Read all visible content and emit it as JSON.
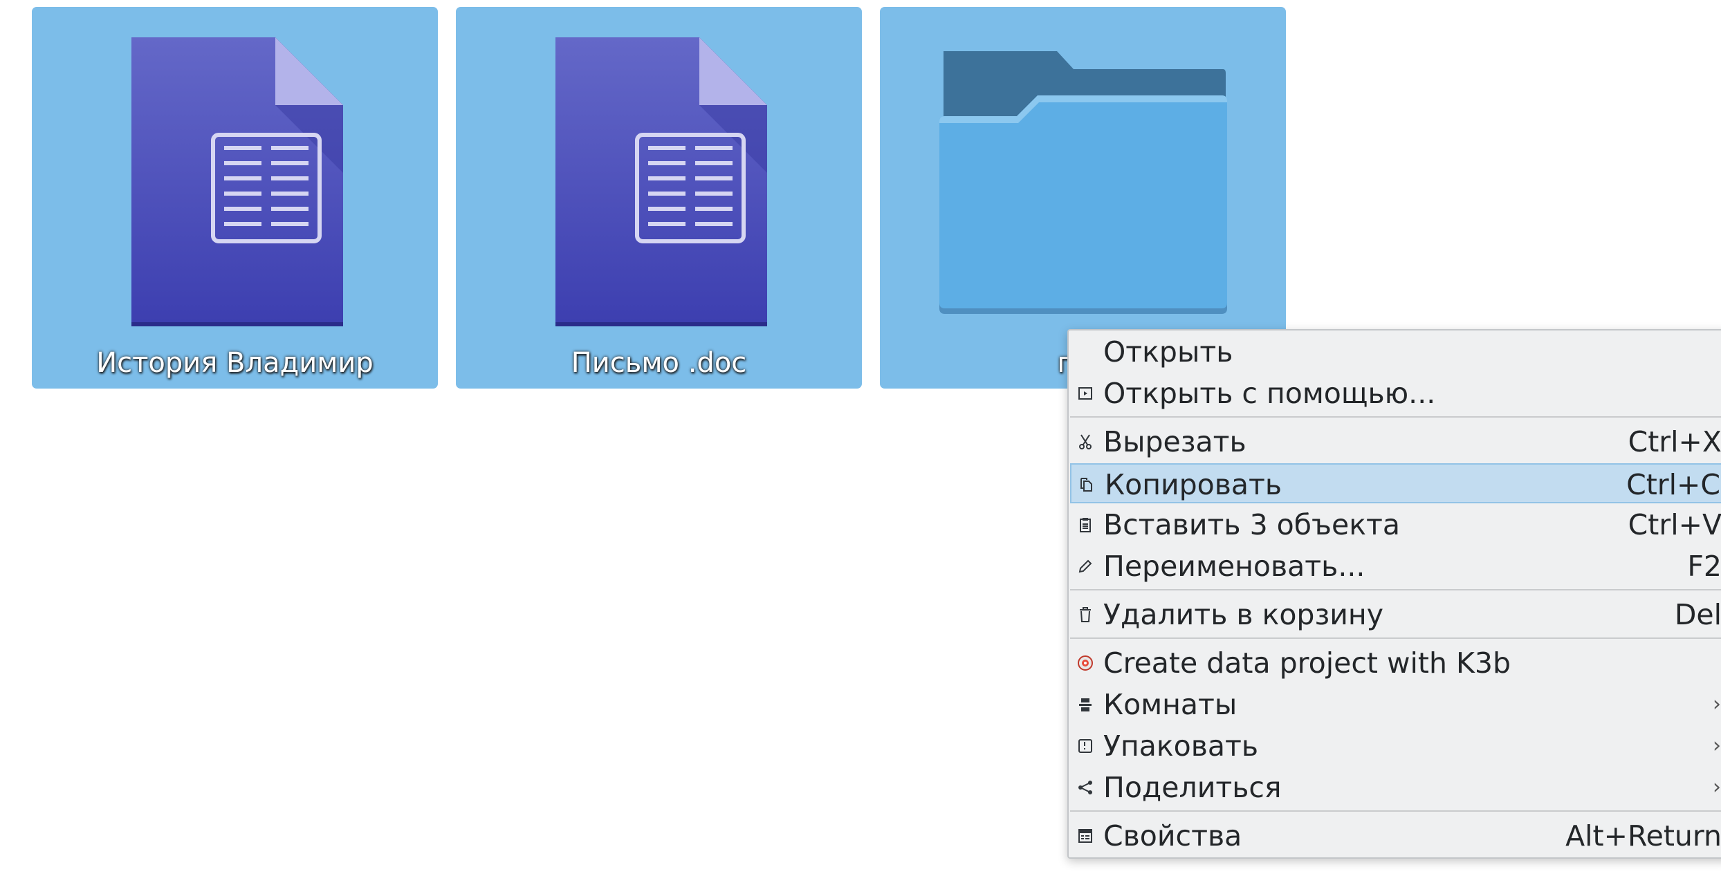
{
  "desktop": {
    "files": [
      {
        "name": "История Владимир",
        "type": "document",
        "icon": "document-icon",
        "selected": true
      },
      {
        "name": "Письмо .doc",
        "type": "document",
        "icon": "document-icon",
        "selected": true
      },
      {
        "name": "пис",
        "type": "folder",
        "icon": "folder-icon",
        "selected": true
      }
    ],
    "selection_color": "#7cbde9"
  },
  "context_menu": {
    "items": [
      {
        "label": "Открыть",
        "shortcut": "",
        "icon": "",
        "submenu": false
      },
      {
        "label": "Открыть с помощью...",
        "shortcut": "",
        "icon": "open-with-icon",
        "submenu": false
      },
      {
        "label": "Вырезать",
        "shortcut": "Ctrl+X",
        "icon": "scissors-icon",
        "submenu": false
      },
      {
        "label": "Копировать",
        "shortcut": "Ctrl+C",
        "icon": "copy-icon",
        "submenu": false,
        "highlighted": true
      },
      {
        "label": "Вставить 3 объекта",
        "shortcut": "Ctrl+V",
        "icon": "paste-icon",
        "submenu": false
      },
      {
        "label": "Переименовать...",
        "shortcut": "F2",
        "icon": "pencil-icon",
        "submenu": false
      },
      {
        "label": "Удалить в корзину",
        "shortcut": "Del",
        "icon": "trash-icon",
        "submenu": false
      },
      {
        "label": "Create data project with K3b",
        "shortcut": "",
        "icon": "k3b-icon",
        "submenu": false
      },
      {
        "label": "Комнаты",
        "shortcut": "",
        "icon": "activities-icon",
        "submenu": true
      },
      {
        "label": "Упаковать",
        "shortcut": "",
        "icon": "archive-icon",
        "submenu": true
      },
      {
        "label": "Поделиться",
        "shortcut": "",
        "icon": "share-icon",
        "submenu": true
      },
      {
        "label": "Свойства",
        "shortcut": "Alt+Return",
        "icon": "properties-icon",
        "submenu": false
      }
    ],
    "submenu_arrow": "›",
    "highlight_color": "#c2dcf0"
  }
}
